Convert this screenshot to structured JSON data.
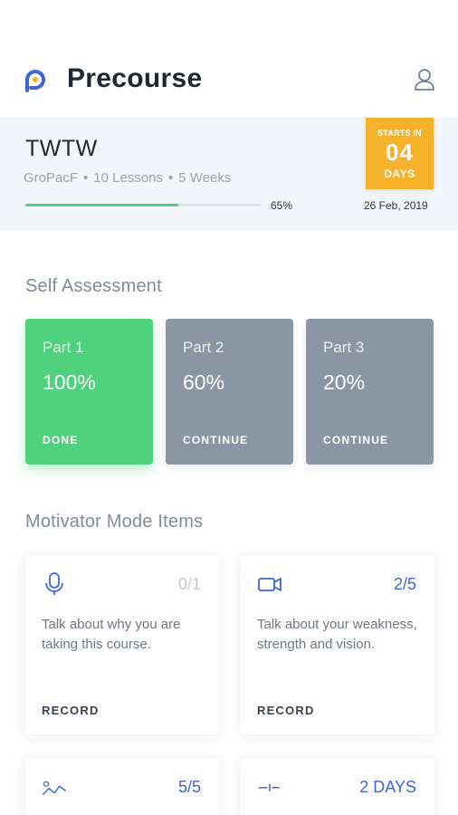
{
  "header": {
    "title": "Precourse",
    "logo_icon": "precourse-logo-icon",
    "profile_icon": "user-icon"
  },
  "course": {
    "name": "TWTW",
    "org": "GroPacF",
    "lessons": "10 Lessons",
    "duration": "5 Weeks",
    "progress_percent": 65,
    "progress_label": "65%",
    "badge_top": "STARTS IN",
    "badge_number": "04",
    "badge_bottom": "DAYS",
    "start_date": "26 Feb, 2019"
  },
  "self_assessment": {
    "title": "Self Assessment",
    "parts": [
      {
        "label": "Part 1",
        "value": "100%",
        "action": "DONE"
      },
      {
        "label": "Part 2",
        "value": "60%",
        "action": "CONTINUE"
      },
      {
        "label": "Part 3",
        "value": "20%",
        "action": "CONTINUE"
      }
    ]
  },
  "motivator": {
    "title": "Motivator Mode Items",
    "items": [
      {
        "icon": "microphone-icon",
        "count": "0/1",
        "text": "Talk about why you are taking this course.",
        "action": "RECORD"
      },
      {
        "icon": "video-camera-icon",
        "count": "2/5",
        "text": "Talk about your weakness, strength and vision.",
        "action": "RECORD"
      },
      {
        "icon": "trend-line-icon",
        "count": "5/5",
        "text": "",
        "action": ""
      },
      {
        "icon": "timeline-icon",
        "count": "2 DAYS",
        "text": "",
        "action": ""
      }
    ]
  },
  "colors": {
    "accent": "#3f65d6",
    "success": "#4fd17e",
    "warning": "#f7b22c",
    "muted_card": "#8b96a4"
  }
}
